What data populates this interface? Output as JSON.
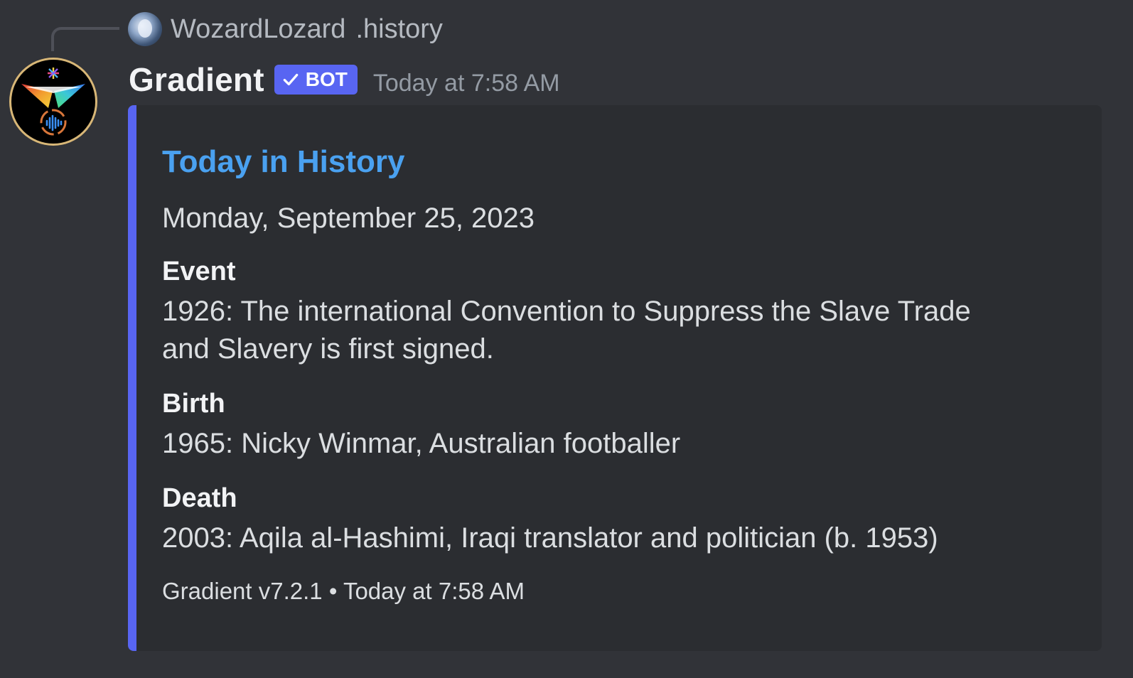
{
  "reply": {
    "username": "WozardLozard",
    "content": ".history"
  },
  "message": {
    "author": "Gradient",
    "bot_tag": "BOT",
    "timestamp": "Today at 7:58 AM"
  },
  "embed": {
    "accent_color": "#5865f2",
    "title": "Today in History",
    "description": "Monday, September 25, 2023",
    "fields": [
      {
        "name": "Event",
        "value": "1926: The international Convention to Suppress the Slave Trade and Slavery is first signed."
      },
      {
        "name": "Birth",
        "value": "1965: Nicky Winmar, Australian footballer"
      },
      {
        "name": "Death",
        "value": "2003: Aqila al-Hashimi, Iraqi translator and politician (b. 1953)"
      }
    ],
    "footer": {
      "text": "Gradient v7.2.1",
      "separator": "•",
      "timestamp": "Today at 7:58 AM"
    }
  },
  "colors": {
    "background": "#313338",
    "embed_background": "#2b2d31",
    "link": "#4aa1f0",
    "bot_tag": "#5865f2",
    "muted_text": "#949ba4"
  },
  "icons": [
    "reply-avatar",
    "bot-avatar",
    "verified-check-icon"
  ]
}
